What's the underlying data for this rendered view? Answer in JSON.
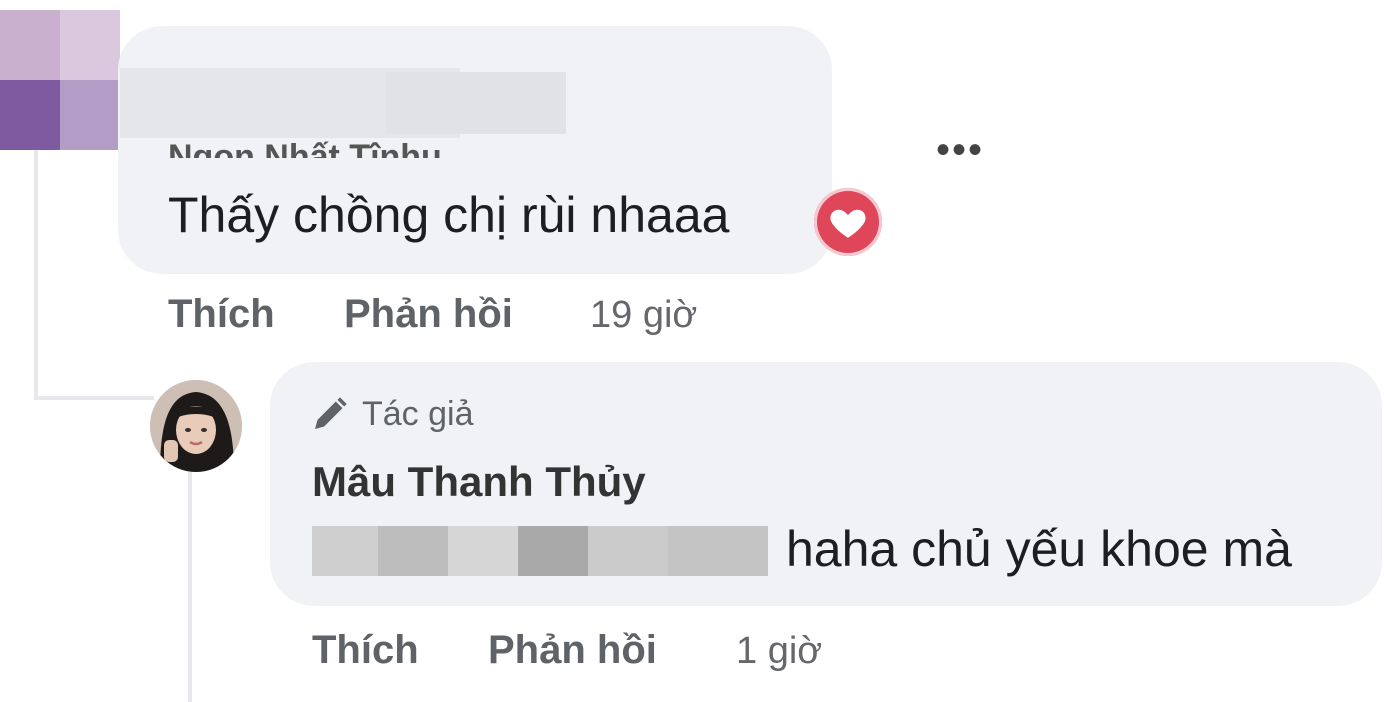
{
  "comments": [
    {
      "author_partial": "Ngọn Nhất Tînhu",
      "text": "Thấy chồng chị rùi nhaaa",
      "reaction_icon": "heart-icon",
      "actions": {
        "like": "Thích",
        "reply": "Phản hồi"
      },
      "time": "19 giờ",
      "more": "•••"
    }
  ],
  "reply": {
    "badge": "Tác giả",
    "badge_icon": "pencil-icon",
    "author": "Mâu Thanh Thủy",
    "text": "haha chủ yếu khoe mà",
    "actions": {
      "like": "Thích",
      "reply": "Phản hồi"
    },
    "time": "1 giờ"
  },
  "colors": {
    "bubble": "#f0f2f5",
    "heart": "#e0465a",
    "action_text": "#5f6368"
  }
}
